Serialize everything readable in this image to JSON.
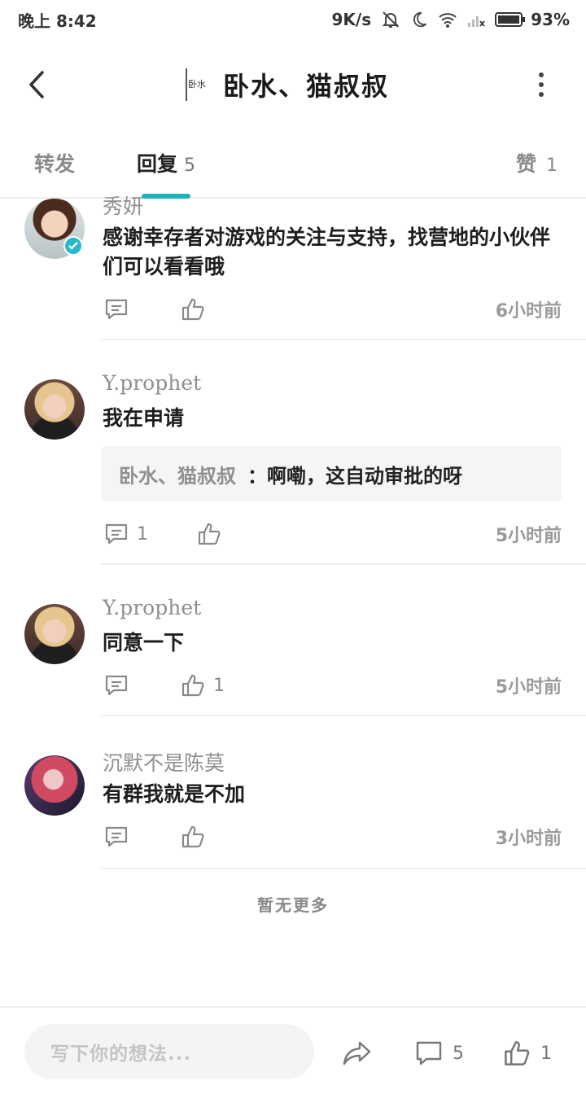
{
  "status_bar": {
    "time": "晚上 8:42",
    "net_speed": "9K/s",
    "battery": "93%"
  },
  "header": {
    "title": "卧水、猫叔叔",
    "avatar_text": "卧水"
  },
  "tabs": {
    "forward": "转发",
    "reply": "回复",
    "reply_count": "5",
    "like": "赞",
    "like_count": "1"
  },
  "comments": [
    {
      "name": "秀妍",
      "text": "感谢幸存者对游戏的关注与支持，找营地的小伙伴们可以看看哦",
      "reply_count": "",
      "like_count": "",
      "time": "6小时前",
      "verified": true
    },
    {
      "name": "Y.prophet",
      "text": "我在申请",
      "quote_name": "卧水、猫叔叔",
      "quote_text": "：啊嘞，这自动审批的呀",
      "reply_count": "1",
      "like_count": "",
      "time": "5小时前"
    },
    {
      "name": "Y.prophet",
      "text": "同意一下",
      "reply_count": "",
      "like_count": "1",
      "time": "5小时前"
    },
    {
      "name": "沉默不是陈莫",
      "text": "有群我就是不加",
      "reply_count": "",
      "like_count": "",
      "time": "3小时前"
    }
  ],
  "footer_note": "暂无更多",
  "bottom_bar": {
    "input_placeholder": "写下你的想法...",
    "comment_count": "5",
    "like_count": "1"
  },
  "colors": {
    "accent": "#1fb5b8",
    "verified_badge": "#2ab7c9"
  },
  "icons": [
    "back-arrow-icon",
    "more-vertical-icon",
    "comment-icon",
    "thumbs-up-icon",
    "share-icon",
    "verified-check-icon",
    "mute-bell-icon",
    "moon-icon",
    "wifi-icon",
    "signal-icon",
    "battery-icon"
  ]
}
